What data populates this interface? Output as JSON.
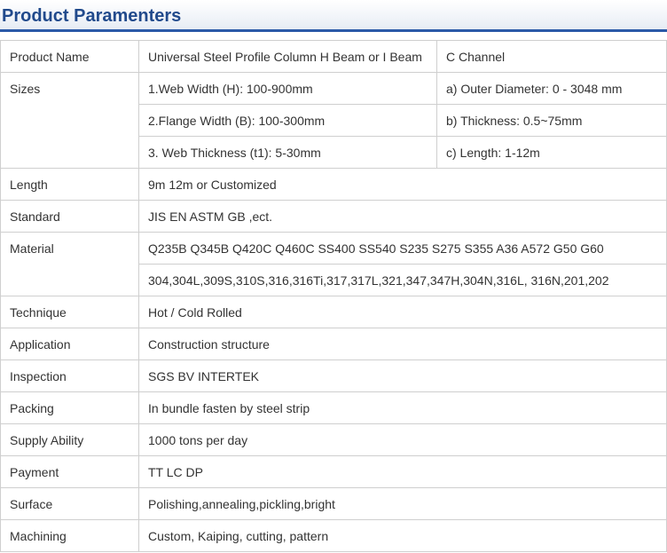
{
  "title": "Product Paramenters",
  "rows": {
    "product_name": {
      "label": "Product Name",
      "value1": "Universal Steel Profile Column H Beam or I Beam",
      "value2": "C Channel"
    },
    "sizes": {
      "label": "Sizes",
      "lines": [
        {
          "left": "1.Web Width (H): 100-900mm",
          "right": "a) Outer Diameter: 0 - 3048 mm"
        },
        {
          "left": "2.Flange Width (B): 100-300mm",
          "right": "b) Thickness: 0.5~75mm"
        },
        {
          "left": "3. Web Thickness (t1): 5-30mm",
          "right": "c) Length: 1-12m"
        }
      ]
    },
    "length": {
      "label": "Length",
      "value": "9m 12m or Customized"
    },
    "standard": {
      "label": "Standard",
      "value": "JIS EN ASTM GB ,ect."
    },
    "material": {
      "label": "Material",
      "lines": [
        "Q235B Q345B Q420C Q460C SS400 SS540 S235 S275 S355 A36 A572 G50 G60",
        "304,304L,309S,310S,316,316Ti,317,317L,321,347,347H,304N,316L, 316N,201,202"
      ]
    },
    "technique": {
      "label": "Technique",
      "value": "Hot / Cold Rolled"
    },
    "application": {
      "label": "Application",
      "value": "Construction structure"
    },
    "inspection": {
      "label": "Inspection",
      "value": "SGS BV INTERTEK"
    },
    "packing": {
      "label": "Packing",
      "value": "In bundle fasten by steel strip"
    },
    "supply_ability": {
      "label": "Supply Ability",
      "value": "1000 tons per day"
    },
    "payment": {
      "label": "Payment",
      "value": "TT LC DP"
    },
    "surface": {
      "label": "Surface",
      "value": "Polishing,annealing,pickling,bright"
    },
    "machining": {
      "label": "Machining",
      "value": "Custom, Kaiping, cutting, pattern"
    }
  }
}
